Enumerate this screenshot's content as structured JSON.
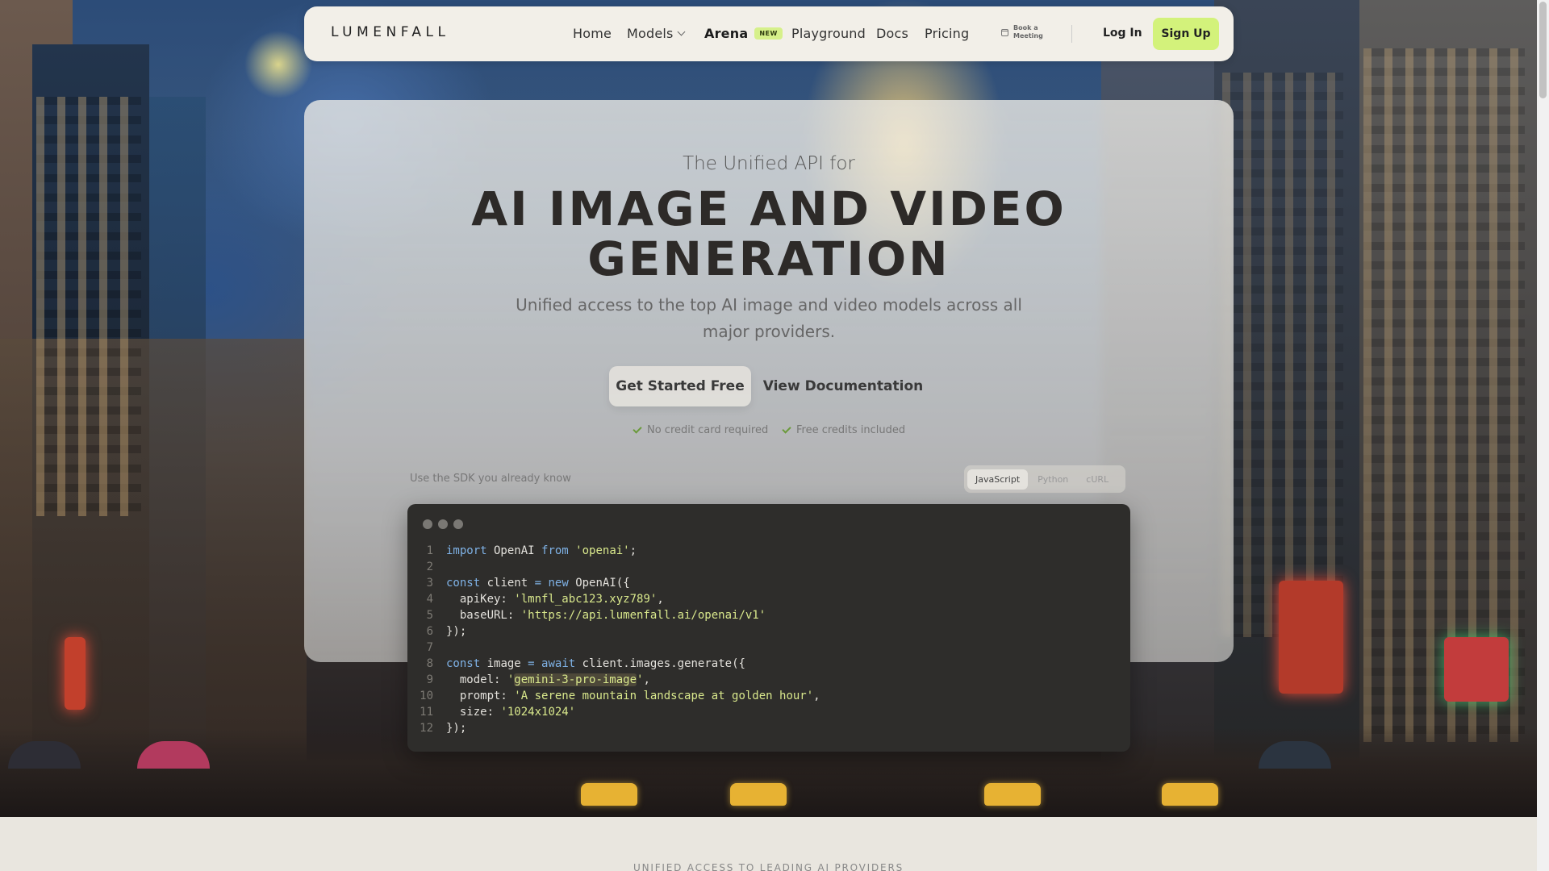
{
  "nav": {
    "logo": "LUMENFALL",
    "home": "Home",
    "models": "Models",
    "arena": "Arena",
    "arena_badge": "NEW",
    "playground": "Playground",
    "docs": "Docs",
    "pricing": "Pricing",
    "book_meeting_line1": "Book a",
    "book_meeting_line2": "Meeting",
    "login": "Log In",
    "signup": "Sign Up"
  },
  "hero": {
    "kicker": "The Unified API for",
    "headline": "AI IMAGE AND VIDEO GENERATION",
    "subhead": "Unified access to the top AI image and video models across all major providers.",
    "cta_primary": "Get Started Free",
    "cta_secondary": "View Documentation",
    "perk_1": "No credit card required",
    "perk_2": "Free credits included",
    "sdk_label": "Use the SDK you already know",
    "lang_tabs": [
      "JavaScript",
      "Python",
      "cURL"
    ]
  },
  "code": {
    "language": "JavaScript",
    "lines": [
      "import OpenAI from 'openai';",
      "",
      "const client = new OpenAI({",
      "  apiKey: 'lmnfl_abc123.xyz789',",
      "  baseURL: 'https://api.lumenfall.ai/openai/v1'",
      "});",
      "",
      "const image = await client.images.generate({",
      "  model: 'gemini-3-pro-image',",
      "  prompt: 'A serene mountain landscape at golden hour',",
      "  size: '1024x1024'",
      "});"
    ]
  },
  "providers": {
    "label": "UNIFIED ACCESS TO LEADING AI PROVIDERS"
  },
  "colors": {
    "accent": "#d3f27b",
    "badge": "#d6f08a",
    "code_bg": "#2e2d2b",
    "keyword": "#7fb2e6",
    "string": "#d9e88c"
  }
}
